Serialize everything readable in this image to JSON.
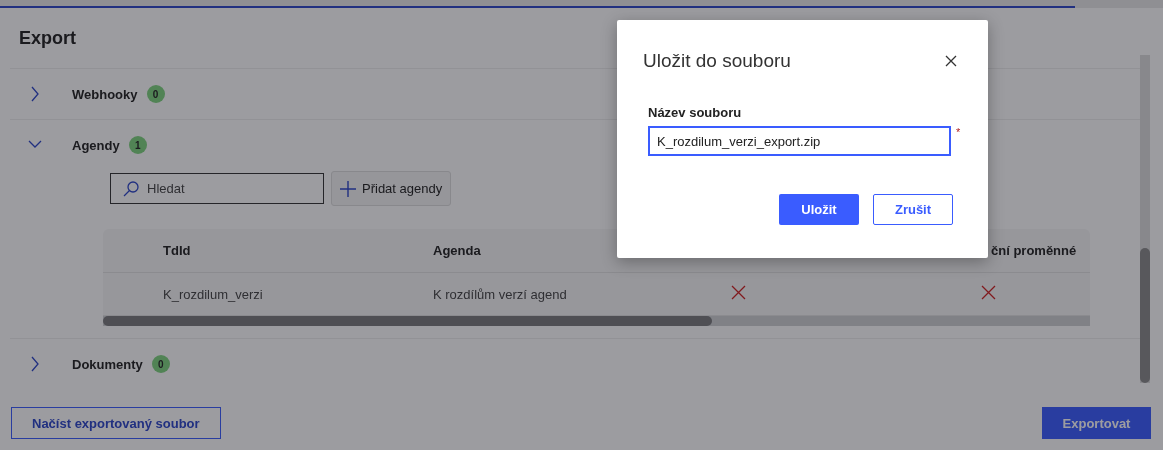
{
  "page": {
    "title": "Export"
  },
  "sections": [
    {
      "title": "Webhooky",
      "count": "0",
      "expanded": false
    },
    {
      "title": "Agendy",
      "count": "1",
      "expanded": true,
      "search": {
        "placeholder": "Hledat"
      },
      "add_button": "Přidat agendy",
      "table": {
        "columns": [
          {
            "label": "TdId"
          },
          {
            "label": "Agenda"
          },
          {},
          {
            "label": "ční proměnné"
          }
        ],
        "rows": [
          [
            {
              "kind": "text",
              "text": "K_rozdilum_verzi"
            },
            {
              "kind": "text",
              "text": "K rozdílům verzí agend"
            },
            {
              "kind": "cross"
            },
            {
              "kind": "cross"
            }
          ]
        ]
      }
    },
    {
      "title": "Dokumenty",
      "count": "0",
      "expanded": false
    }
  ],
  "footer": {
    "load_button": "Načíst exportovaný soubor",
    "export_button": "Exportovat"
  },
  "dialog": {
    "title": "Uložit do souboru",
    "field_label": "Název souboru",
    "field_value": "K_rozdilum_verzi_export.zip",
    "required_mark": "*",
    "save_button": "Uložit",
    "cancel_button": "Zrušit"
  }
}
